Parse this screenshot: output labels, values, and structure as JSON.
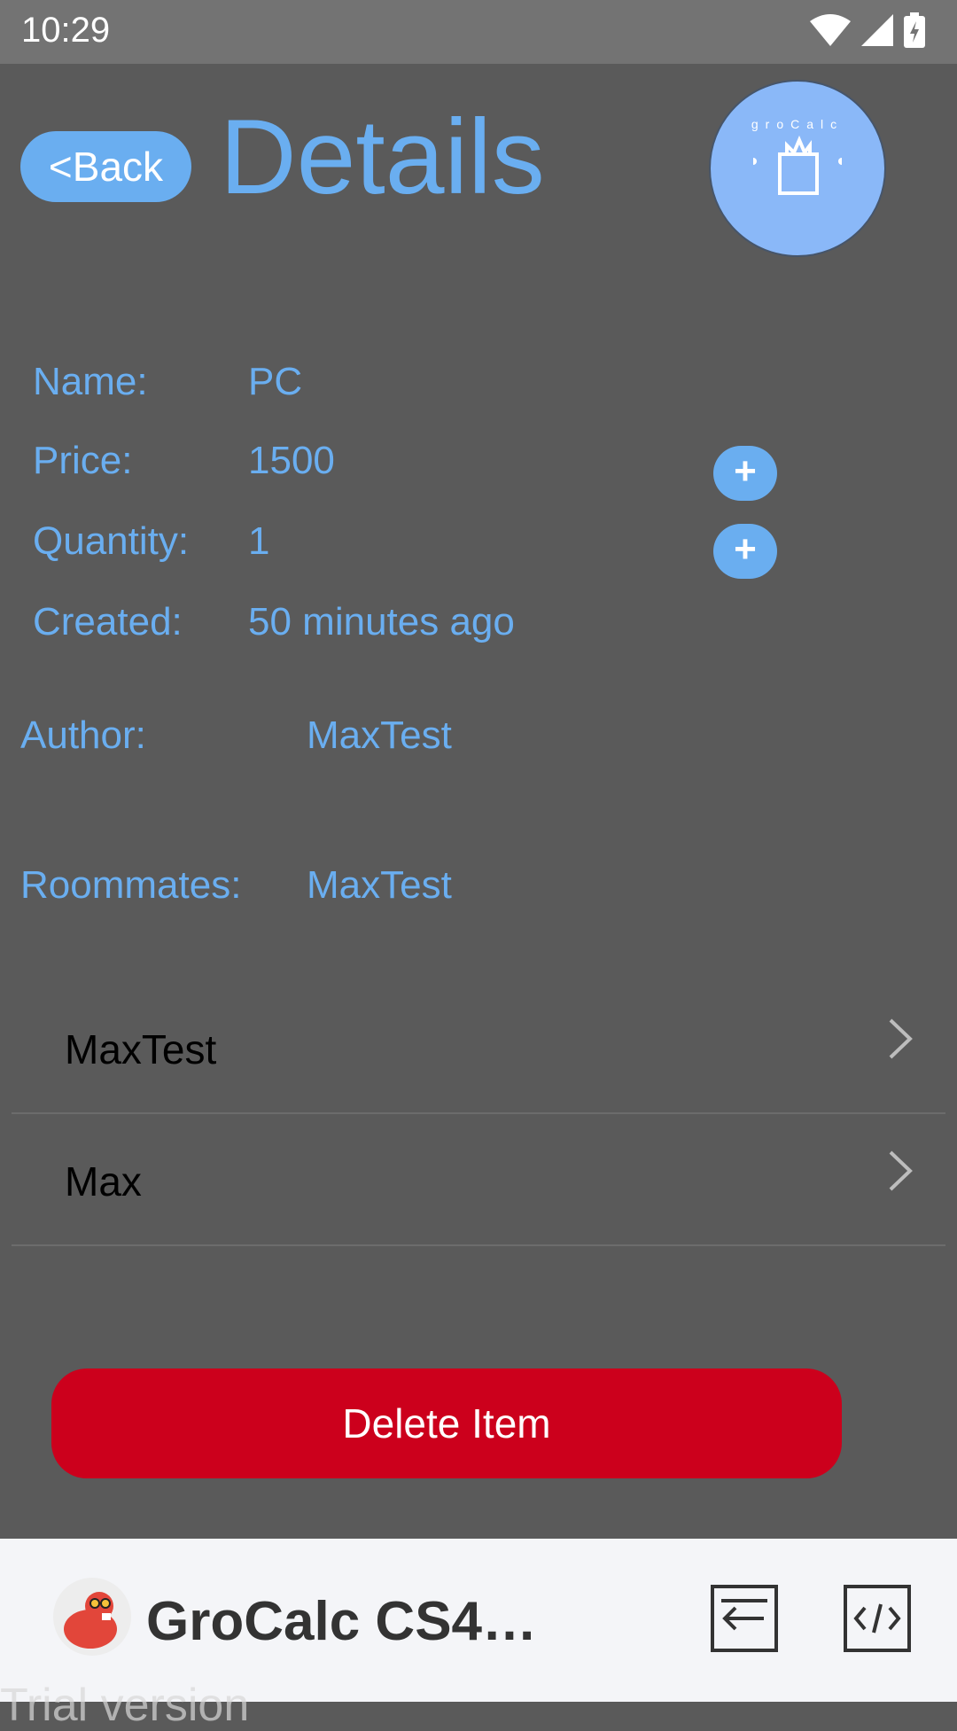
{
  "status_bar": {
    "time": "10:29",
    "icons": [
      "wifi-icon",
      "signal-icon",
      "battery-charging-icon"
    ]
  },
  "header": {
    "back_label": "<Back",
    "title": "Details",
    "logo_text": "groCalc"
  },
  "fields": [
    {
      "label": "Name:",
      "value": "PC"
    },
    {
      "label": "Price:",
      "value": "1500"
    },
    {
      "label": "Quantity:",
      "value": "1"
    },
    {
      "label": "Created:",
      "value": "50 minutes ago"
    }
  ],
  "plus_buttons": [
    "+",
    "+"
  ],
  "author": {
    "label": "Author:",
    "value": "MaxTest"
  },
  "roommates": {
    "label": "Roommates:",
    "value": "MaxTest"
  },
  "roommate_list": [
    "MaxTest",
    "Max"
  ],
  "delete_label": "Delete Item",
  "bottom_bar": {
    "app_name": "GroCalc CS4R...",
    "trial_text": "Trial version"
  },
  "colors": {
    "background": "#5a5a5a",
    "accent": "#6aaef0",
    "danger": "#cc001c",
    "logo_bg": "#8ab8f8"
  }
}
